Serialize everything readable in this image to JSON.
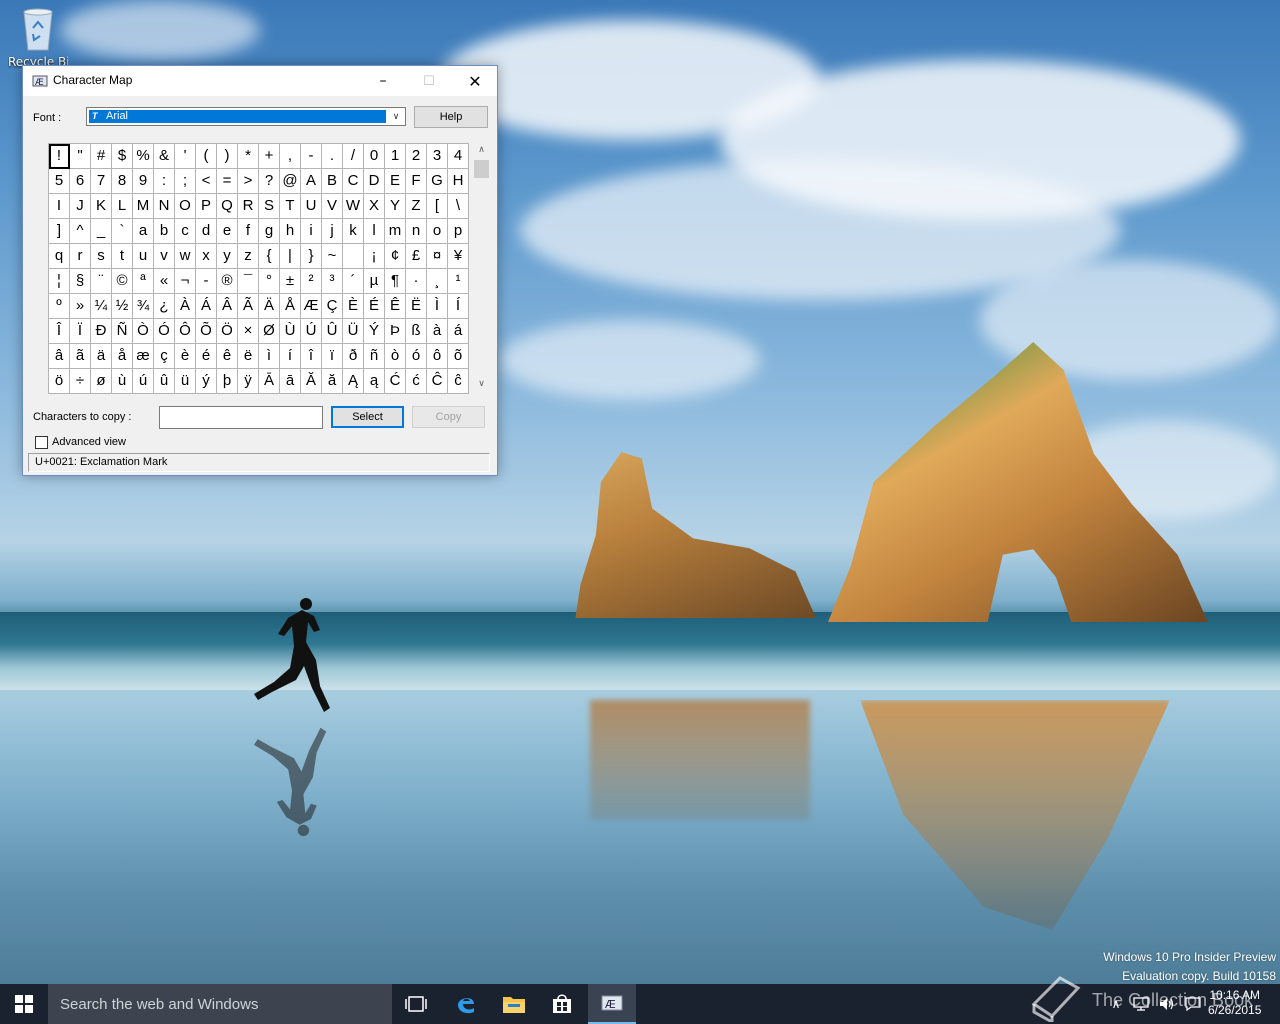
{
  "desktop": {
    "recycle_bin_label": "Recycle Bin"
  },
  "window": {
    "title": "Character Map",
    "font_label": "Font :",
    "font_value": "Arial",
    "help_label": "Help",
    "grid_rows": [
      [
        "!",
        "\"",
        "#",
        "$",
        "%",
        "&",
        "'",
        "(",
        ")",
        "*",
        "+",
        ",",
        "-",
        ".",
        "/",
        "0",
        "1",
        "2",
        "3",
        "4"
      ],
      [
        "5",
        "6",
        "7",
        "8",
        "9",
        ":",
        ";",
        "<",
        "=",
        ">",
        "?",
        "@",
        "A",
        "B",
        "C",
        "D",
        "E",
        "F",
        "G",
        "H"
      ],
      [
        "I",
        "J",
        "K",
        "L",
        "M",
        "N",
        "O",
        "P",
        "Q",
        "R",
        "S",
        "T",
        "U",
        "V",
        "W",
        "X",
        "Y",
        "Z",
        "[",
        "\\"
      ],
      [
        "]",
        "^",
        "_",
        "`",
        "a",
        "b",
        "c",
        "d",
        "e",
        "f",
        "g",
        "h",
        "i",
        "j",
        "k",
        "l",
        "m",
        "n",
        "o",
        "p"
      ],
      [
        "q",
        "r",
        "s",
        "t",
        "u",
        "v",
        "w",
        "x",
        "y",
        "z",
        "{",
        "|",
        "}",
        "~",
        " ",
        "¡",
        "¢",
        "£",
        "¤",
        "¥"
      ],
      [
        "¦",
        "§",
        "¨",
        "©",
        "ª",
        "«",
        "¬",
        "-",
        "®",
        "¯",
        "°",
        "±",
        "²",
        "³",
        "´",
        "µ",
        "¶",
        "·",
        "¸",
        "¹"
      ],
      [
        "º",
        "»",
        "¼",
        "½",
        "¾",
        "¿",
        "À",
        "Á",
        "Â",
        "Ã",
        "Ä",
        "Å",
        "Æ",
        "Ç",
        "È",
        "É",
        "Ê",
        "Ë",
        "Ì",
        "Í"
      ],
      [
        "Î",
        "Ï",
        "Ð",
        "Ñ",
        "Ò",
        "Ó",
        "Ô",
        "Õ",
        "Ö",
        "×",
        "Ø",
        "Ù",
        "Ú",
        "Û",
        "Ü",
        "Ý",
        "Þ",
        "ß",
        "à",
        "á"
      ],
      [
        "â",
        "ã",
        "ä",
        "å",
        "æ",
        "ç",
        "è",
        "é",
        "ê",
        "ë",
        "ì",
        "í",
        "î",
        "ï",
        "ð",
        "ñ",
        "ò",
        "ó",
        "ô",
        "õ"
      ],
      [
        "ö",
        "÷",
        "ø",
        "ù",
        "ú",
        "û",
        "ü",
        "ý",
        "þ",
        "ÿ",
        "Ā",
        "ā",
        "Ă",
        "ă",
        "Ą",
        "ą",
        "Ć",
        "ć",
        "Ĉ",
        "ĉ"
      ]
    ],
    "selected_char": "!",
    "chars_to_copy_label": "Characters to copy :",
    "chars_to_copy_value": "",
    "select_label": "Select",
    "copy_label": "Copy",
    "advanced_view_label": "Advanced view",
    "advanced_view_checked": false,
    "status_text": "U+0021: Exclamation Mark"
  },
  "watermark": {
    "line1": "Windows 10 Pro Insider Preview",
    "line2": "Evaluation copy. Build 10158"
  },
  "taskbar": {
    "search_placeholder": "Search the web and Windows",
    "clock_time": "10:16 AM",
    "clock_date": "6/26/2015",
    "overlay_text": "The Collection Book",
    "accent_color": "#76b9ed"
  },
  "icons": [
    "recycle-bin-icon",
    "charmap-icon",
    "windows-start-icon",
    "task-view-icon",
    "edge-icon",
    "file-explorer-icon",
    "store-icon",
    "chevron-up-icon",
    "network-icon",
    "volume-icon",
    "action-center-icon",
    "book-icon"
  ]
}
